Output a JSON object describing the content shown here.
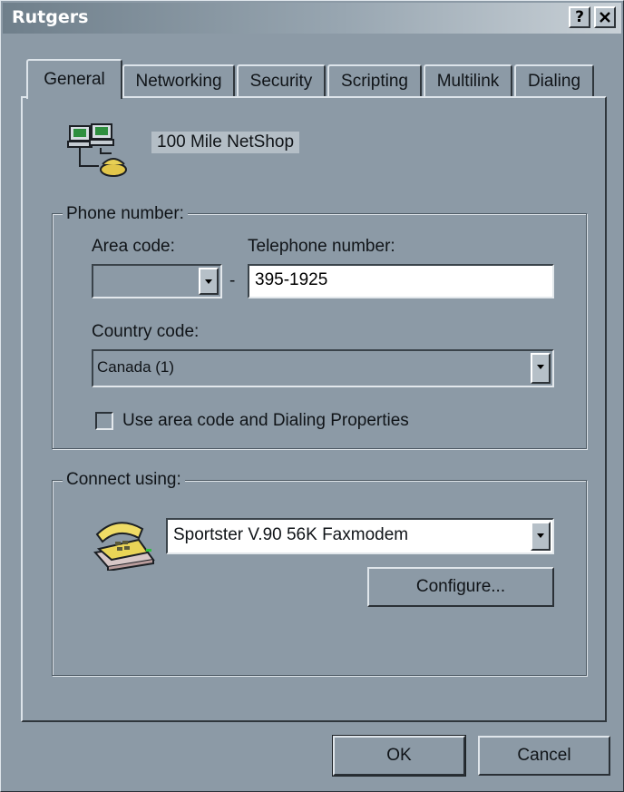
{
  "window": {
    "title": "Rutgers",
    "help_button": "?",
    "close_button": "✕"
  },
  "tabs": [
    {
      "label": "General",
      "active": true
    },
    {
      "label": "Networking",
      "active": false
    },
    {
      "label": "Security",
      "active": false
    },
    {
      "label": "Scripting",
      "active": false
    },
    {
      "label": "Multilink",
      "active": false
    },
    {
      "label": "Dialing",
      "active": false
    }
  ],
  "connection": {
    "name": "100 Mile NetShop",
    "icon": "dialup-network-icon"
  },
  "phone": {
    "legend": "Phone number:",
    "area_code_label": "Area code:",
    "area_code_value": "",
    "separator": "-",
    "telephone_label": "Telephone number:",
    "telephone_value": "395-1925",
    "country_label": "Country code:",
    "country_value": "Canada (1)",
    "use_area_code_label": "Use area code and Dialing Properties",
    "use_area_code_checked": false
  },
  "connect": {
    "legend": "Connect using:",
    "device_icon": "modem-phone-icon",
    "device_value": "Sportster V.90 56K Faxmodem",
    "configure_label": "Configure..."
  },
  "buttons": {
    "ok": "OK",
    "cancel": "Cancel"
  }
}
